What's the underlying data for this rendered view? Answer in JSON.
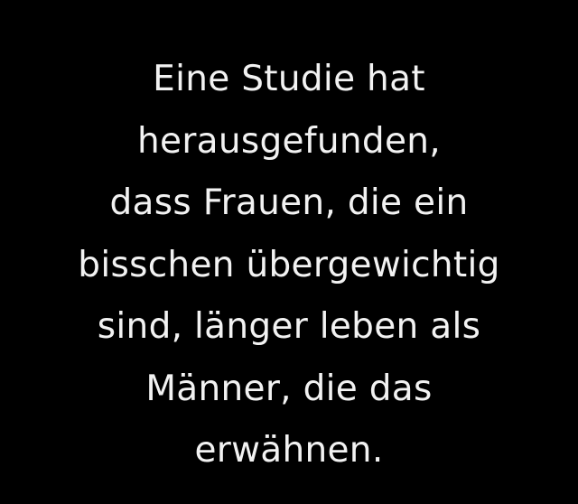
{
  "background_color": "#000000",
  "text_color": "#f2f2f2",
  "quote": {
    "lines": [
      "Eine Studie hat",
      "herausgefunden,",
      "dass Frauen, die ein",
      "bisschen übergewichtig",
      "sind, länger leben als",
      "Männer, die das",
      "erwähnen."
    ]
  }
}
